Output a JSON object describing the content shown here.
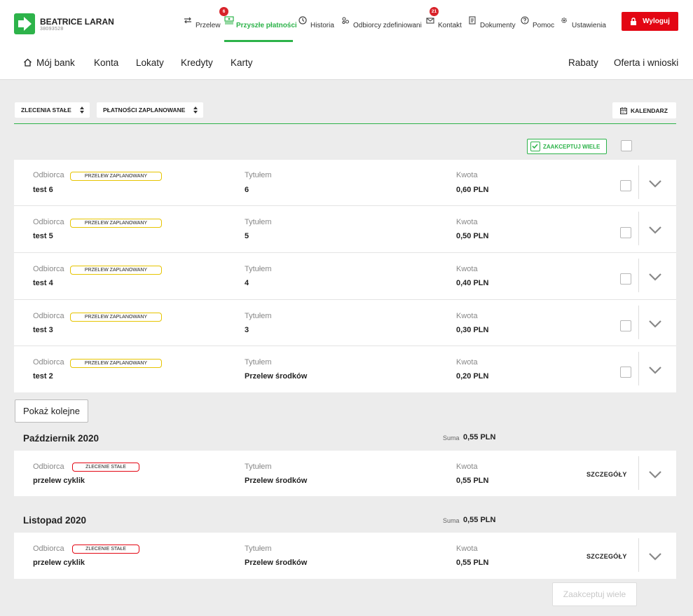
{
  "header": {
    "user_name": "BEATRICE LARAN",
    "user_id": "38093528",
    "nav": [
      {
        "label": "Przelew",
        "icon": "transfer-icon"
      },
      {
        "label": "Przyszłe płatności",
        "icon": "future-payments-icon",
        "badge": "6",
        "active": true
      },
      {
        "label": "Historia",
        "icon": "history-icon"
      },
      {
        "label": "Odbiorcy zdefiniowani",
        "icon": "recipients-icon"
      },
      {
        "label": "Kontakt",
        "icon": "mail-icon",
        "badge": "21"
      },
      {
        "label": "Dokumenty",
        "icon": "documents-icon"
      },
      {
        "label": "Pomoc",
        "icon": "help-icon"
      },
      {
        "label": "Ustawienia",
        "icon": "gear-icon"
      }
    ],
    "logout_label": "Wyloguj"
  },
  "menu": {
    "home": "Mój bank",
    "items": [
      "Konta",
      "Lokaty",
      "Kredyty",
      "Karty"
    ],
    "right": [
      "Rabaty",
      "Oferta i wnioski"
    ]
  },
  "filters": {
    "standing_orders": "ZLECENIA STAŁE",
    "scheduled_payments": "PŁATNOŚCI ZAPLANOWANE",
    "calendar": "KALENDARZ"
  },
  "accept_many_label": "ZAAKCEPTUJ WIELE",
  "labels": {
    "recipient": "Odbiorca",
    "title": "Tytułem",
    "amount": "Kwota",
    "details": "SZCZEGÓŁY",
    "sum": "Suma"
  },
  "scheduled": [
    {
      "tag": "PRZELEW ZAPLANOWANY",
      "recipient": "test 6",
      "title": "6",
      "amount": "0,60 PLN"
    },
    {
      "tag": "PRZELEW ZAPLANOWANY",
      "recipient": "test 5",
      "title": "5",
      "amount": "0,50 PLN"
    },
    {
      "tag": "PRZELEW ZAPLANOWANY",
      "recipient": "test 4",
      "title": "4",
      "amount": "0,40 PLN"
    },
    {
      "tag": "PRZELEW ZAPLANOWANY",
      "recipient": "test 3",
      "title": "3",
      "amount": "0,30 PLN"
    },
    {
      "tag": "PRZELEW ZAPLANOWANY",
      "recipient": "test 2",
      "title": "Przelew środków",
      "amount": "0,20 PLN"
    }
  ],
  "show_more_label": "Pokaż kolejne",
  "months": [
    {
      "name": "Październik 2020",
      "sum": "0,55 PLN",
      "row": {
        "tag": "ZLECENIE STAŁE",
        "recipient": "przelew cyklik",
        "title": "Przelew środków",
        "amount": "0,55 PLN"
      }
    },
    {
      "name": "Listopad 2020",
      "sum": "0,55 PLN",
      "row": {
        "tag": "ZLECENIE STAŁE",
        "recipient": "przelew cyklik",
        "title": "Przelew środków",
        "amount": "0,55 PLN"
      }
    }
  ],
  "accept_many_bottom_label": "Zaakceptuj wiele",
  "colors": {
    "brand_green": "#2db34a",
    "logout_red": "#e30613",
    "tag_yellow": "#e6c400",
    "tag_red": "#e30613"
  }
}
